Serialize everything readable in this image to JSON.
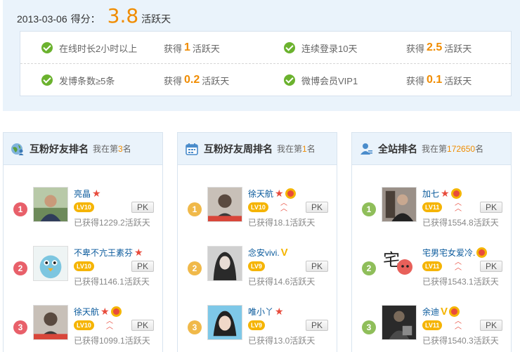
{
  "score": {
    "date": "2013-03-06",
    "label": "得分：",
    "value": "3.8",
    "unit": "活跃天"
  },
  "tasks": [
    {
      "name": "在线时长2小时以上",
      "prefix": "获得",
      "value": "1",
      "unit": "活跃天"
    },
    {
      "name": "连续登录10天",
      "prefix": "获得",
      "value": "2.5",
      "unit": "活跃天"
    },
    {
      "name": "发博条数≥5条",
      "prefix": "获得",
      "value": "0.2",
      "unit": "活跃天"
    },
    {
      "name": "微博会员VIP1",
      "prefix": "获得",
      "value": "0.1",
      "unit": "活跃天"
    }
  ],
  "panels": [
    {
      "title": "互粉好友排名",
      "rank_prefix": "我在第",
      "rank": "3",
      "rank_suffix": "名",
      "badge_color": "#e8606a",
      "entries": [
        {
          "rank": "1",
          "name": "亮晶",
          "level": "LV10",
          "pk": "PK",
          "earned": "已获得1229.2活跃天"
        },
        {
          "rank": "2",
          "name": "不卑不亢王素芬",
          "level": "LV10",
          "pk": "PK",
          "earned": "已获得1146.1活跃天"
        },
        {
          "rank": "3",
          "name": "徐天航",
          "level": "LV10",
          "pk": "PK",
          "earned": "已获得1099.1活跃天"
        }
      ]
    },
    {
      "title": "互粉好友周排名",
      "rank_prefix": "我在第",
      "rank": "1",
      "rank_suffix": "名",
      "badge_color": "#f0b94a",
      "entries": [
        {
          "rank": "1",
          "name": "徐天航",
          "level": "LV10",
          "pk": "PK",
          "earned": "已获得18.1活跃天"
        },
        {
          "rank": "2",
          "name": "念安vivi.",
          "level": "LV9",
          "pk": "PK",
          "earned": "已获得14.6活跃天"
        },
        {
          "rank": "3",
          "name": "唯小丫",
          "level": "LV9",
          "pk": "PK",
          "earned": "已获得13.0活跃天"
        }
      ]
    },
    {
      "title": "全站排名",
      "rank_prefix": "我在第",
      "rank": "172650",
      "rank_suffix": "名",
      "badge_color": "#8fbe5a",
      "entries": [
        {
          "rank": "1",
          "name": "加七",
          "level": "LV11",
          "pk": "PK",
          "earned": "已获得1554.8活跃天"
        },
        {
          "rank": "2",
          "name": "宅男宅女爱冷.",
          "level": "LV11",
          "pk": "PK",
          "earned": "已获得1543.1活跃天"
        },
        {
          "rank": "3",
          "name": "余迪",
          "level": "LV11",
          "pk": "PK",
          "earned": "已获得1540.3活跃天"
        }
      ]
    }
  ]
}
